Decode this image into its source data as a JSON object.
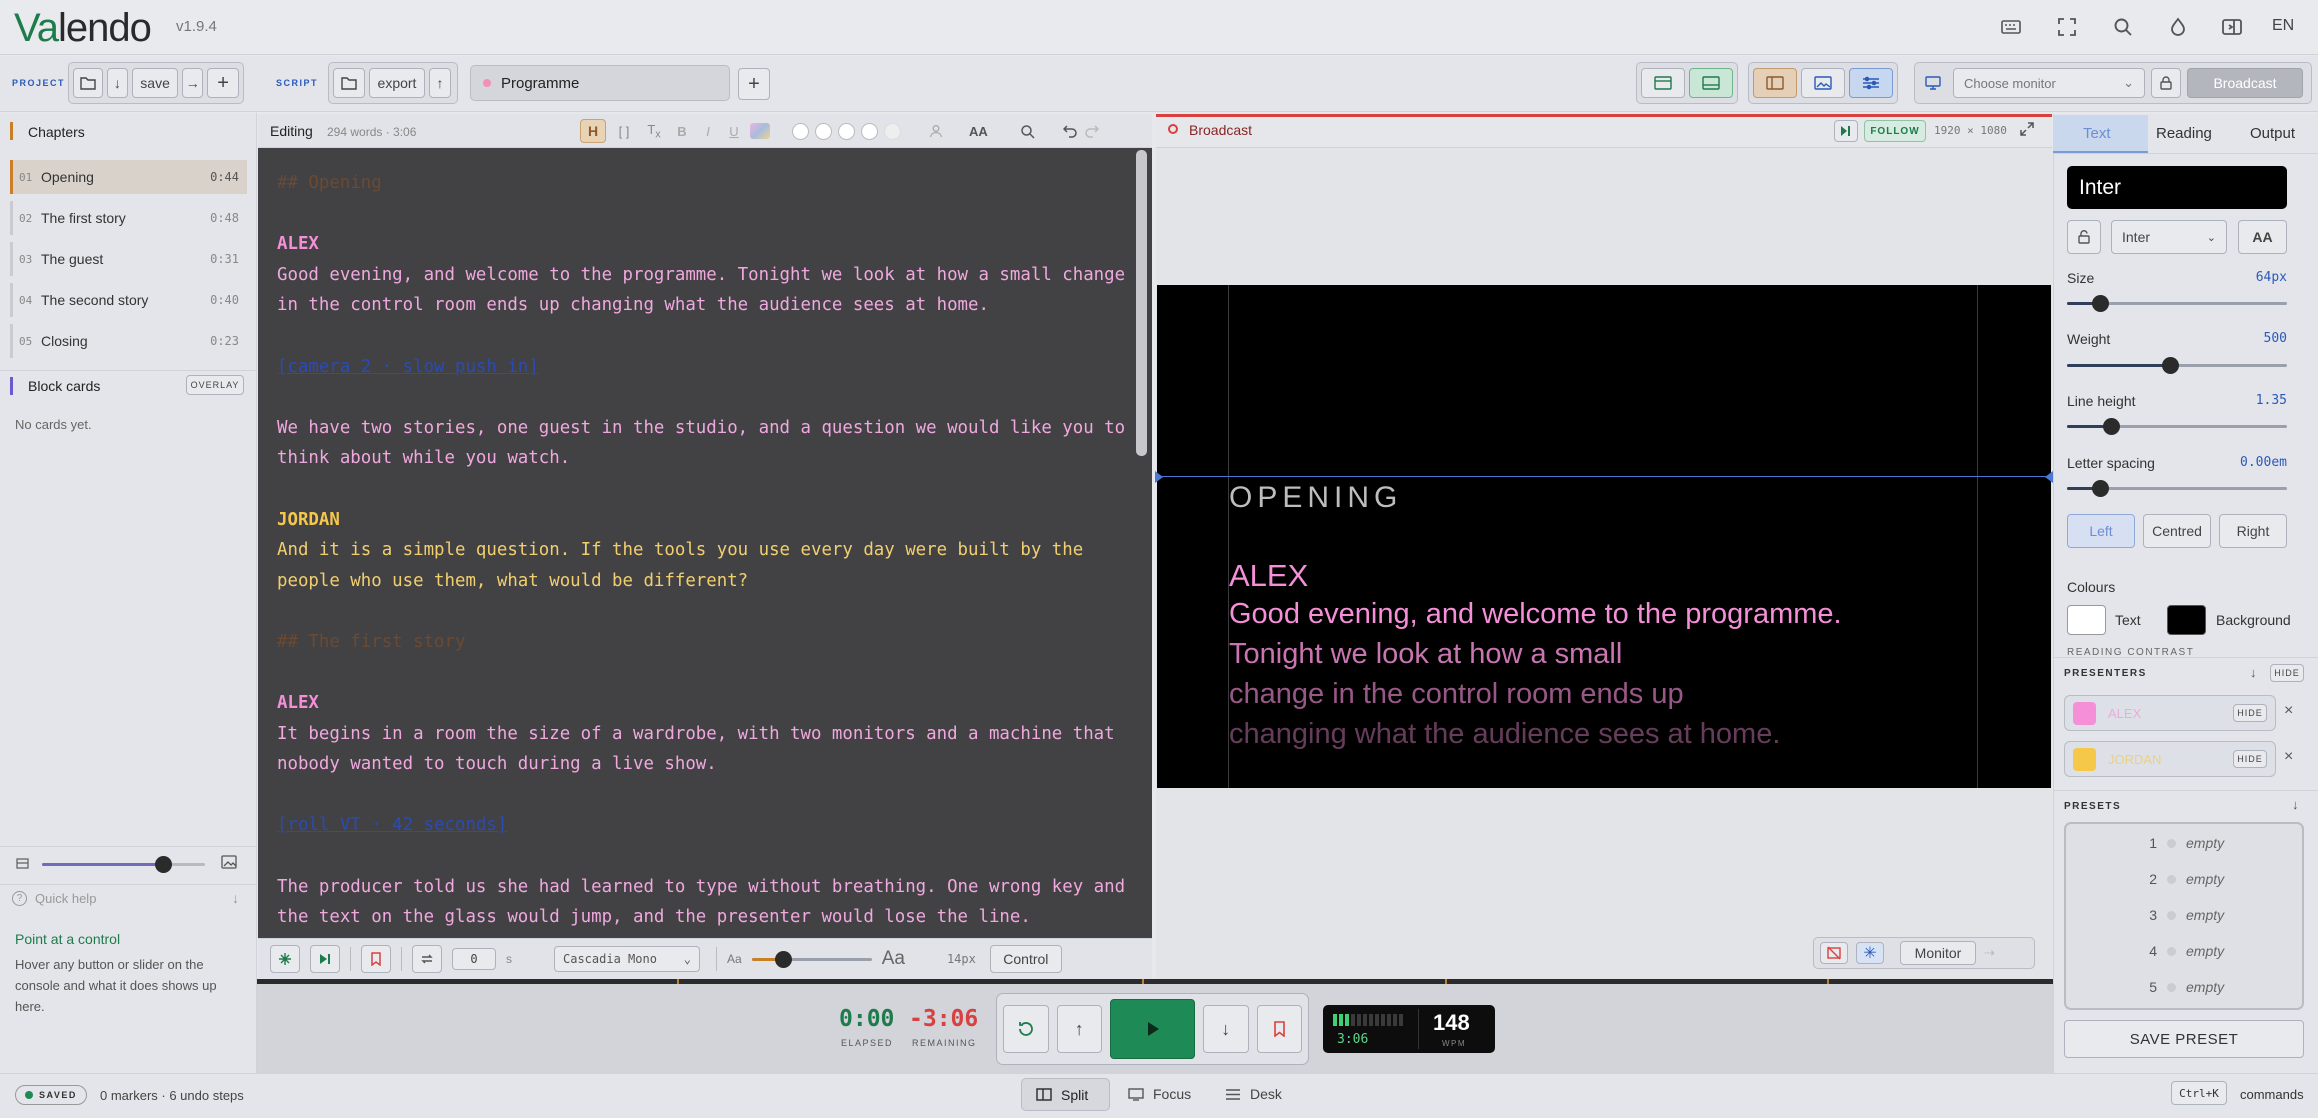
{
  "app": {
    "logo_va": "Va",
    "logo_rest": "lendo",
    "version": "v1.9.4",
    "lang": "EN"
  },
  "toolbar": {
    "project_label": "PROJECT",
    "save_label": "save",
    "script_label": "SCRIPT",
    "export_label": "export",
    "script_tab": "Programme",
    "monitor_placeholder": "Choose monitor",
    "broadcast_label": "Broadcast"
  },
  "sidebar": {
    "chapters_title": "Chapters",
    "chapters": [
      {
        "num": "01",
        "title": "Opening",
        "dur": "0:44",
        "active": true
      },
      {
        "num": "02",
        "title": "The first story",
        "dur": "0:48",
        "active": false
      },
      {
        "num": "03",
        "title": "The guest",
        "dur": "0:31",
        "active": false
      },
      {
        "num": "04",
        "title": "The second story",
        "dur": "0:40",
        "active": false
      },
      {
        "num": "05",
        "title": "Closing",
        "dur": "0:23",
        "active": false
      }
    ],
    "block_cards_title": "Block cards",
    "overlay_label": "OVERLAY",
    "no_cards": "No cards yet.",
    "zoom_value": 0.74,
    "quick_help_label": "Quick help",
    "help_title": "Point at a control",
    "help_text": "Hover any button or slider on the console and what it does shows up here."
  },
  "editor": {
    "title": "Editing",
    "meta": "294 words · 3:06",
    "heading_btn": "H",
    "aa_label": "AA",
    "lines": [
      {
        "t": "## Opening",
        "k": "head",
        "c": "#6a4a33"
      },
      {
        "t": "",
        "k": "blank",
        "c": "#ffffff"
      },
      {
        "t": "ALEX",
        "k": "speaker",
        "c": "#f48fd8"
      },
      {
        "t": "Good evening, and welcome to the programme. Tonight we look at how a small change",
        "k": "text",
        "c": "#f0a8df"
      },
      {
        "t": "in the control room ends up changing what the audience sees at home.",
        "k": "text",
        "c": "#f0a8df"
      },
      {
        "t": "",
        "k": "blank",
        "c": "#ffffff"
      },
      {
        "t": "[camera 2 · slow push in]",
        "k": "cue",
        "c": "#2a4bb5"
      },
      {
        "t": "",
        "k": "blank",
        "c": "#ffffff"
      },
      {
        "t": "We have two stories, one guest in the studio, and a question we would like you to",
        "k": "text",
        "c": "#f0a8df"
      },
      {
        "t": "think about while you watch.",
        "k": "text",
        "c": "#f0a8df"
      },
      {
        "t": "",
        "k": "blank",
        "c": "#ffffff"
      },
      {
        "t": "JORDAN",
        "k": "speaker",
        "c": "#f5c84a"
      },
      {
        "t": "And it is a simple question. If the tools you use every day were built by the",
        "k": "text",
        "c": "#f2cf6e"
      },
      {
        "t": "people who use them, what would be different?",
        "k": "text",
        "c": "#f2cf6e"
      },
      {
        "t": "",
        "k": "blank",
        "c": "#ffffff"
      },
      {
        "t": "## The first story",
        "k": "head",
        "c": "#6a4a33"
      },
      {
        "t": "",
        "k": "blank",
        "c": "#ffffff"
      },
      {
        "t": "ALEX",
        "k": "speaker",
        "c": "#f48fd8"
      },
      {
        "t": "It begins in a room the size of a wardrobe, with two monitors and a machine that",
        "k": "text",
        "c": "#f0a8df"
      },
      {
        "t": "nobody wanted to touch during a live show.",
        "k": "text",
        "c": "#f0a8df"
      },
      {
        "t": "",
        "k": "blank",
        "c": "#ffffff"
      },
      {
        "t": "[roll VT · 42 seconds]",
        "k": "cue",
        "c": "#2a4bb5"
      },
      {
        "t": "",
        "k": "blank",
        "c": "#ffffff"
      },
      {
        "t": "The producer told us she had learned to type without breathing. One wrong key and",
        "k": "text",
        "c": "#f0a8df"
      },
      {
        "t": "the text on the glass would jump, and the presenter would lose the line.",
        "k": "text",
        "c": "#f0a8df"
      }
    ],
    "footer": {
      "seconds_value": "0",
      "seconds_unit": "s",
      "font_name": "Cascadia Mono",
      "aa_small": "Aa",
      "aa_large": "Aa",
      "font_size": "14px",
      "control_label": "Control",
      "font_size_value": 0.26
    }
  },
  "broadcast": {
    "title": "Broadcast",
    "follow_label": "FOLLOW",
    "resolution": "1920 × 1080",
    "heading": "OPENING",
    "speaker": "ALEX",
    "lines": [
      {
        "t": "Good evening, and welcome to the programme.",
        "o": 1.0
      },
      {
        "t": "Tonight we look at how a small",
        "o": 0.82
      },
      {
        "t": "change in the control room ends up",
        "o": 0.62
      },
      {
        "t": "changing what the audience sees at home.",
        "o": 0.42
      }
    ],
    "monitor_label": "Monitor"
  },
  "right": {
    "tabs": [
      "Text",
      "Reading",
      "Output"
    ],
    "active_tab": "Text",
    "font_display": "Inter",
    "font_select": "Inter",
    "aa_label": "AA",
    "size_label": "Size",
    "size_value": "64px",
    "size_level": 0.15,
    "weight_label": "Weight",
    "weight_value": "500",
    "weight_level": 0.47,
    "line_height_label": "Line height",
    "line_height_value": "1.35",
    "line_height_level": 0.2,
    "letter_spacing_label": "Letter spacing",
    "letter_spacing_value": "0.00em",
    "letter_spacing_level": 0.15,
    "align": [
      "Left",
      "Centred",
      "Right"
    ],
    "colours_label": "Colours",
    "text_label": "Text",
    "background_label": "Background",
    "reading_contrast_label": "READING CONTRAST",
    "presenters_label": "PRESENTERS",
    "hide_label": "HIDE",
    "presenters": [
      {
        "name": "ALEX",
        "color": "#f48fd8"
      },
      {
        "name": "JORDAN",
        "color": "#f5c84a"
      }
    ],
    "presets_label": "PRESETS",
    "presets": [
      {
        "num": "1",
        "label": "empty"
      },
      {
        "num": "2",
        "label": "empty"
      },
      {
        "num": "3",
        "label": "empty"
      },
      {
        "num": "4",
        "label": "empty"
      },
      {
        "num": "5",
        "label": "empty"
      }
    ],
    "save_preset_label": "SAVE PRESET"
  },
  "transport": {
    "elapsed": "0:00",
    "elapsed_label": "ELAPSED",
    "remaining": "-3:06",
    "remaining_label": "REMAINING",
    "meter_time": "3:06",
    "wpm": "148",
    "wpm_label": "WPM",
    "meter_level": 0.25
  },
  "status": {
    "saved_label": "SAVED",
    "markers": "0 markers · 6 undo steps",
    "views": [
      "Split",
      "Focus",
      "Desk"
    ],
    "active_view": "Split",
    "shortcut": "Ctrl+K",
    "commands_label": "commands"
  },
  "colors": {
    "accent_green": "#1e7b4b",
    "brand_blue": "#2a5ab8",
    "remaining_red": "#d94040",
    "alex": "#f48fd8",
    "jordan": "#f5c84a"
  }
}
